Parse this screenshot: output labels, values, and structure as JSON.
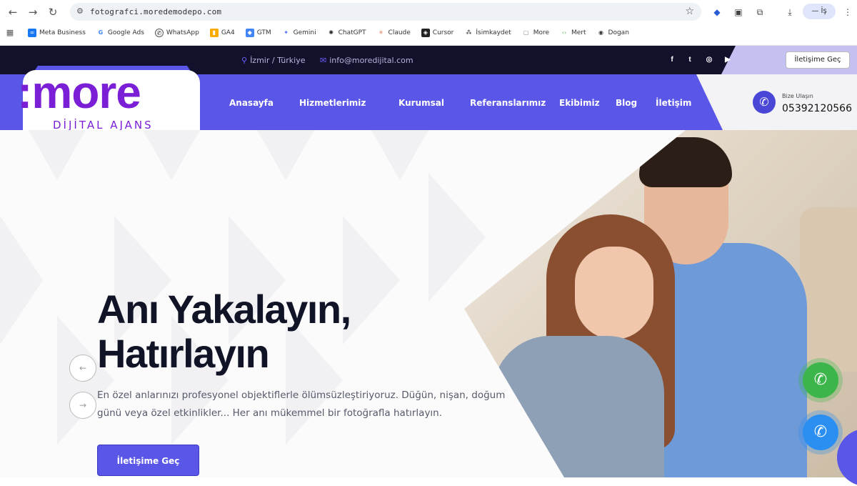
{
  "browser": {
    "url": "fotografci.moredemodepo.com",
    "profile_label": "— İş",
    "bookmarks": [
      "Meta Business",
      "Google Ads",
      "WhatsApp",
      "GA4",
      "GTM",
      "Gemini",
      "ChatGPT",
      "Claude",
      "Cursor",
      "İsimkaydet",
      "More",
      "Mert",
      "Dogan"
    ]
  },
  "topbar": {
    "location": "İzmir / Türkiye",
    "email": "info@moredijital.com",
    "cta": "İletişime Geç",
    "social": [
      "f",
      "t",
      "ig",
      "yt"
    ]
  },
  "header": {
    "logo": ":more",
    "logo_sub": "DİJİTAL AJANS",
    "menu": [
      "Anasayfa",
      "Hizmetlerimiz",
      "Kurumsal",
      "Referanslarımız",
      "Ekibimiz",
      "Blog",
      "İletişim"
    ],
    "contact_label": "Bize Ulaşın",
    "phone": "05392120566"
  },
  "hero": {
    "title_line1": "Anı Yakalayın,",
    "title_line2": "Hatırlayın",
    "description": "En özel anlarınızı profesyonel objektiflerle ölümsüzleştiriyoruz. Düğün, nişan, doğum günü veya özel etkinlikler... Her anı mükemmel bir fotoğrafla hatırlayın.",
    "cta": "İletişime Geç"
  },
  "colors": {
    "primary": "#5a56e8",
    "dark": "#13102b",
    "logo": "#7a1fd6"
  }
}
